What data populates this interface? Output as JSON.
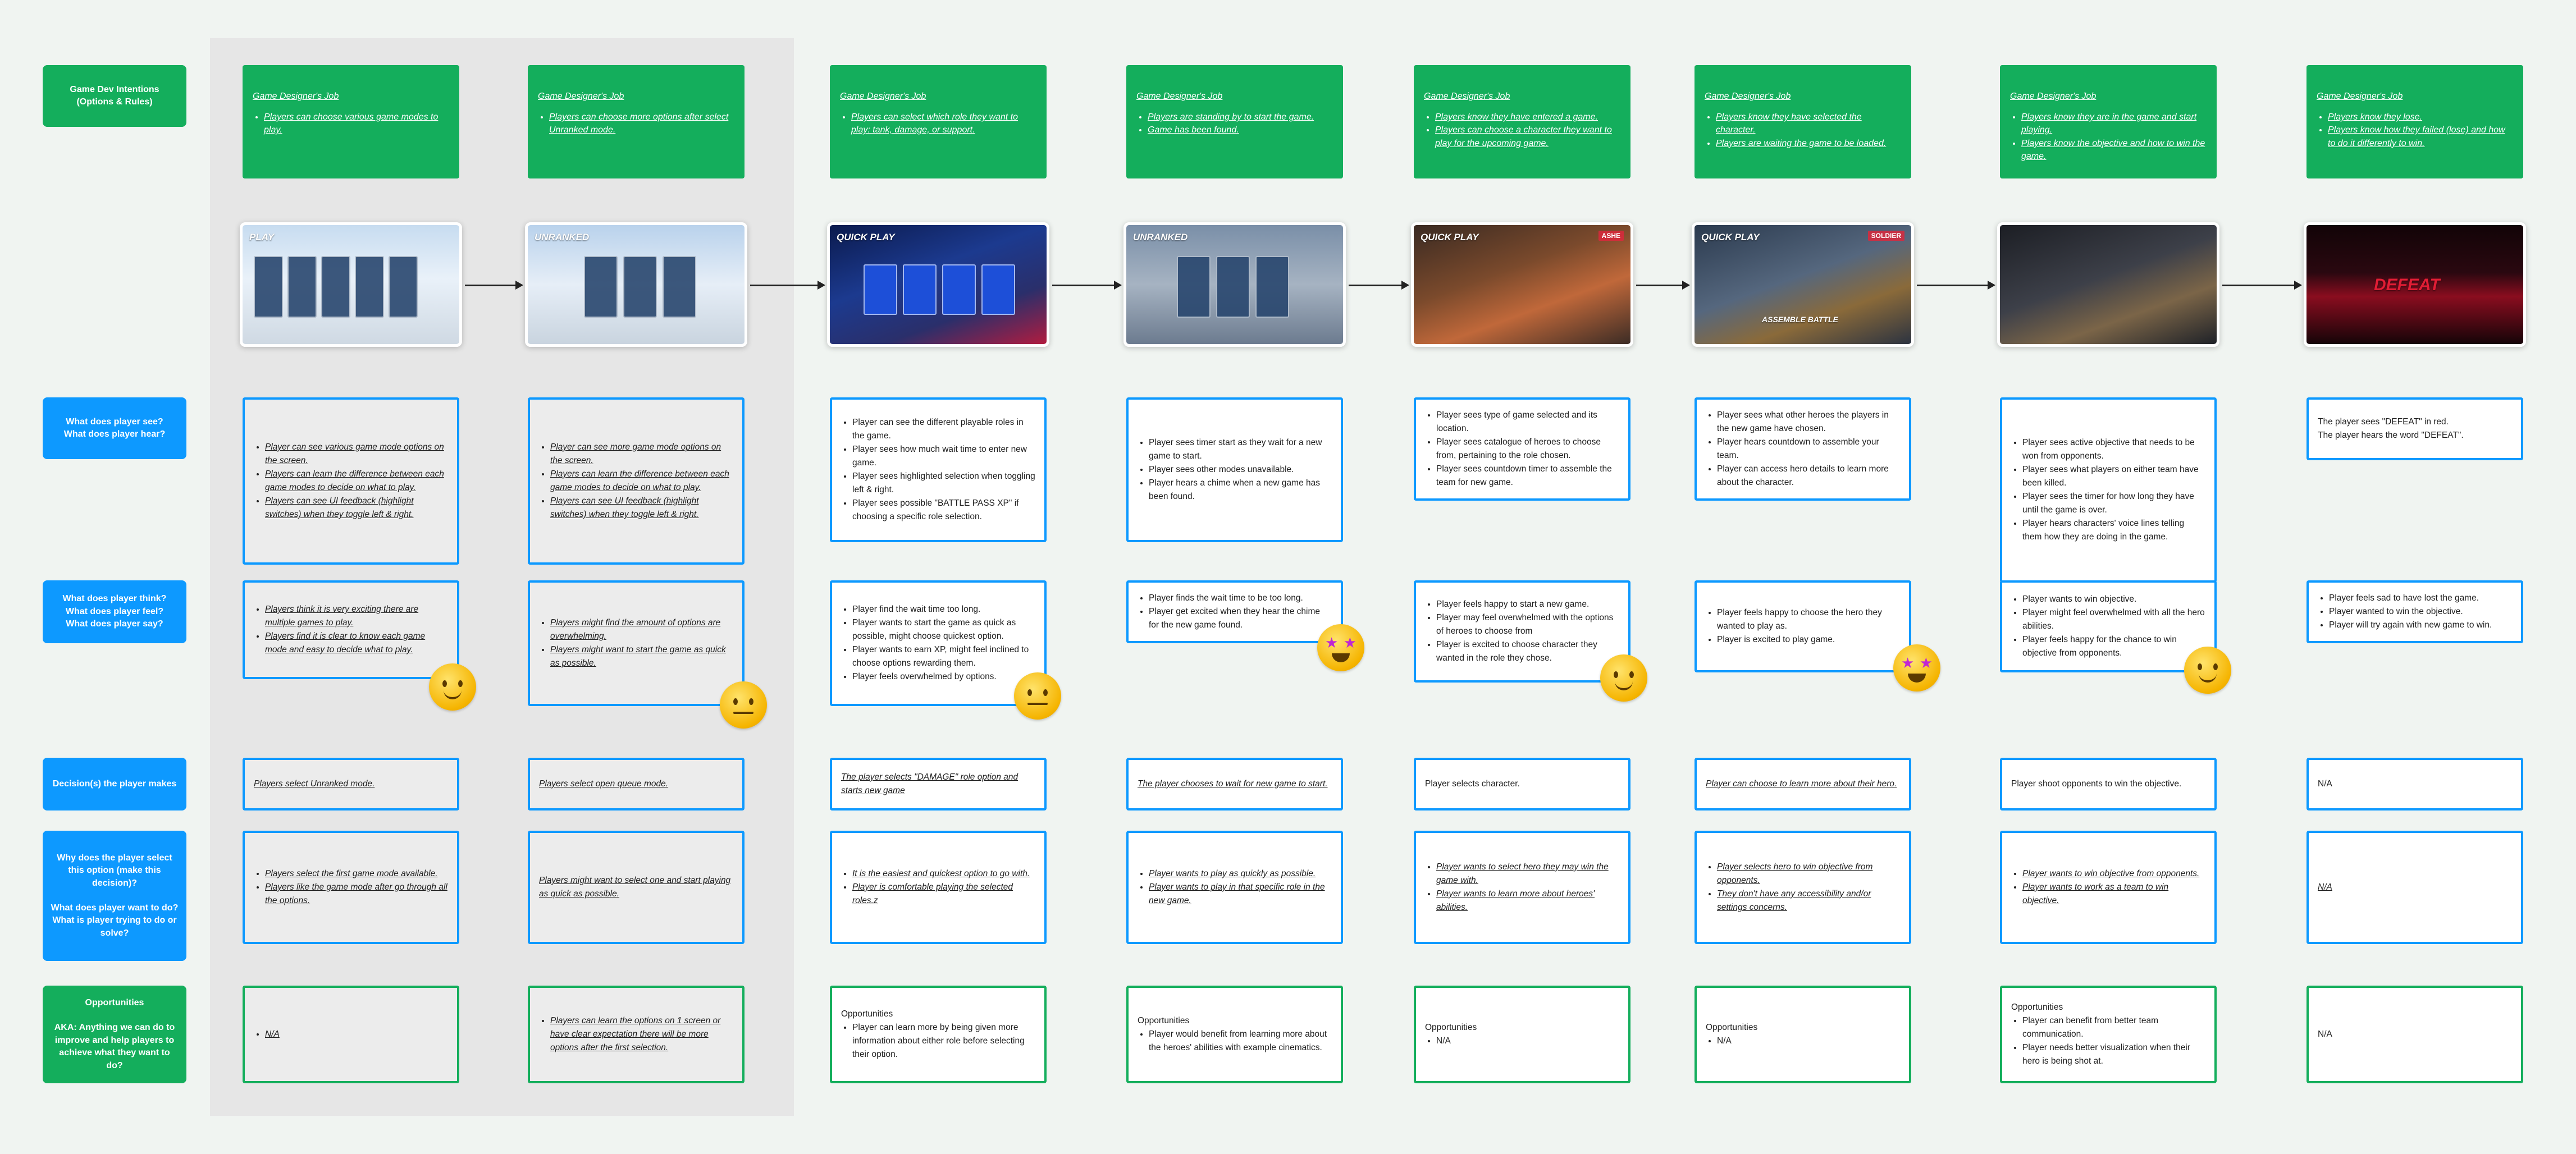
{
  "row_labels": {
    "intentions": "Game Dev Intentions\n(Options & Rules)",
    "see_hear": [
      "What does player see?",
      "What does player hear?"
    ],
    "think_feel_say": [
      "What does player think?",
      "What does player feel?",
      "What does player say?"
    ],
    "decisions": "Decision(s) the player makes",
    "why": [
      "Why does the player select this option (make this decision)?",
      "What does player want to do?",
      "What is player trying to do or solve?"
    ],
    "opportunities": [
      "Opportunities",
      "AKA: Anything we can do to improve and help players to achieve what they want to do?"
    ]
  },
  "colors": {
    "green": "#14ae5c",
    "blue": "#0d99ff",
    "shade": "#e6e6e6",
    "background": "#f0f4f1"
  },
  "columns": [
    {
      "job_title": "Game Designer's Job",
      "job_items": [
        "Players can choose various game modes to play."
      ],
      "screen_caption": "PLAY",
      "see_hear": [
        "Player can see various game mode options on the screen.",
        "Players can learn the difference between each game modes to decide on what to play.",
        "Players can see UI feedback (highlight switches) when they toggle left & right."
      ],
      "think_feel": [
        "Players think it is very exciting there are multiple games to play.",
        "Players find it is clear to know each game mode and easy to decide what to play."
      ],
      "emoji": "slightly-smiling-face-icon",
      "decision": "Players select Unranked mode.",
      "why": [
        "Players select the first game mode available.",
        "Players like the game mode after go through all the options."
      ],
      "opportunities": [
        "N/A"
      ]
    },
    {
      "job_title": "Game Designer's Job",
      "job_items": [
        "Players can choose more options after select Unranked mode."
      ],
      "screen_caption": "UNRANKED",
      "see_hear": [
        "Player can see more game mode options on the screen.",
        "Players can learn the difference between each game modes to decide on what to play.",
        "Players can see UI feedback (highlight switches) when they toggle left & right."
      ],
      "think_feel": [
        "Players might find the amount of options are overwhelming.",
        "Players might want to start the game as quick as possible."
      ],
      "emoji": "neutral-face-icon",
      "decision": "Players select open queue mode.",
      "why_text": "Players might want to select one and start playing as quick as possible.",
      "opportunities": [
        "Players can learn the options on 1 screen or have clear expectation there will be more options after the first selection."
      ]
    },
    {
      "job_title": "Game Designer's Job",
      "job_items": [
        "Players can select which role they want to play: tank, damage, or support."
      ],
      "screen_caption": "QUICK PLAY",
      "see_hear": [
        "Player can see the different playable roles in the game.",
        "Player sees how much wait time to enter new game.",
        "Player sees highlighted selection when toggling left & right.",
        "Player sees possible \"BATTLE PASS XP\" if choosing a specific role selection."
      ],
      "think_feel": [
        "Player find the wait time too long.",
        "Player wants to start the game as quick as possible, might choose quickest option.",
        "Player wants to earn XP, might feel inclined to choose options rewarding them.",
        "Player feels overwhelmed by options."
      ],
      "emoji": "neutral-face-icon",
      "decision": "The player selects \"DAMAGE\" role option and starts new game",
      "why": [
        "It is the easiest and quickest option to go with.",
        "Player is comfortable playing the selected roles.z"
      ],
      "opp_title": "Opportunities",
      "opportunities": [
        "Player can learn more by being given more information about either role before selecting their option."
      ]
    },
    {
      "job_title": "Game Designer's Job",
      "job_items": [
        "Players are standing by to start the game.",
        "Game has been found."
      ],
      "screen_caption": "UNRANKED",
      "see_hear": [
        "Player sees timer start as they wait for a new game to start.",
        "Player sees other modes unavailable.",
        "Player hears a chime when a new game has been found."
      ],
      "think_feel": [
        "Player finds the wait time to be too long.",
        "Player get excited when they hear the chime for the new game found."
      ],
      "emoji": "star-struck-icon",
      "decision": "The player chooses to wait for new game to start.",
      "why": [
        "Player wants to play as quickly as possible.",
        "Player wants to play in that specific role in the new game."
      ],
      "opp_title": "Opportunities",
      "opportunities": [
        "Player would benefit from learning more about the heroes' abilities with example cinematics."
      ]
    },
    {
      "job_title": "Game Designer's Job",
      "job_items": [
        "Players know they have entered a game.",
        "Players can choose a character they want to play for the upcoming game."
      ],
      "screen_caption": "QUICK PLAY",
      "screen_badge": "ASHE",
      "see_hear": [
        "Player sees type of game selected and its location.",
        "Player sees catalogue of heroes to choose from, pertaining to the role chosen.",
        "Player sees countdown timer to assemble the team for new game."
      ],
      "think_feel": [
        "Player feels happy to start a new game.",
        "Player may feel overwhelmed with the options of heroes to choose from",
        "Player is excited to choose character they wanted in the role they chose."
      ],
      "emoji": "slightly-smiling-face-icon",
      "decision": "Player selects character.",
      "why": [
        "Player wants to select hero they may win the game with.",
        "Player wants to learn more about heroes' abilities."
      ],
      "opp_title": "Opportunities",
      "opportunities": [
        "N/A"
      ]
    },
    {
      "job_title": "Game Designer's Job",
      "job_items": [
        "Players know they have selected the character.",
        "Players are waiting the game to be loaded."
      ],
      "screen_caption": "QUICK PLAY",
      "screen_badge": "SOLDIER",
      "screen_sub": "ASSEMBLE BATTLE",
      "see_hear": [
        "Player sees what other heroes the players in the new game have chosen.",
        "Player hears countdown to assemble your team.",
        "Player can access hero details to learn more about the character."
      ],
      "think_feel": [
        "Player feels happy to choose the hero they wanted to play as.",
        "Player is excited to play game."
      ],
      "emoji": "star-struck-icon",
      "decision": "Player can choose to learn more about their hero.",
      "why": [
        "Player selects hero to win objective from opponents.",
        "They don't have any accessibility and/or settings concerns."
      ],
      "opp_title": "Opportunities",
      "opportunities": [
        "N/A"
      ]
    },
    {
      "job_title": "Game Designer's Job",
      "job_items": [
        "Players know they are in the game and start playing.",
        "Players know the objective and how to win the game."
      ],
      "screen_caption": "",
      "see_hear": [
        "Player sees active objective that needs to be won from opponents.",
        "Player sees what players on either team have been killed.",
        "Player sees the timer for how long they have until the game is over.",
        "Player hears characters' voice lines telling them how they are doing in the game."
      ],
      "think_feel": [
        "Player wants to win objective.",
        "Player might feel overwhelmed with all the hero abilities.",
        "Player feels happy for the chance to win objective from opponents."
      ],
      "emoji": "slightly-smiling-face-icon",
      "decision": "Player shoot opponents to win the objective.",
      "why": [
        "Player wants to win objective from opponents.",
        "Player wants to work as a team to win objective."
      ],
      "opp_title": "Opportunities",
      "opportunities": [
        "Player can benefit from better team communication.",
        "Player needs better visualization when their hero is being shot at."
      ]
    },
    {
      "job_title": "Game Designer's Job",
      "job_items": [
        "Players know they lose.",
        "Players know how they failed (lose) and how to do it differently to win."
      ],
      "screen_caption": "DEFEAT",
      "see_hear_plain": [
        "The player sees \"DEFEAT\" in red.",
        "The player hears the word \"DEFEAT\"."
      ],
      "think_feel": [
        "Player feels sad to have lost the game.",
        "Player wanted to win the objective.",
        "Player will try again with new game to win."
      ],
      "decision": "N/A",
      "why_text": "N/A",
      "opp_text": "N/A"
    }
  ]
}
